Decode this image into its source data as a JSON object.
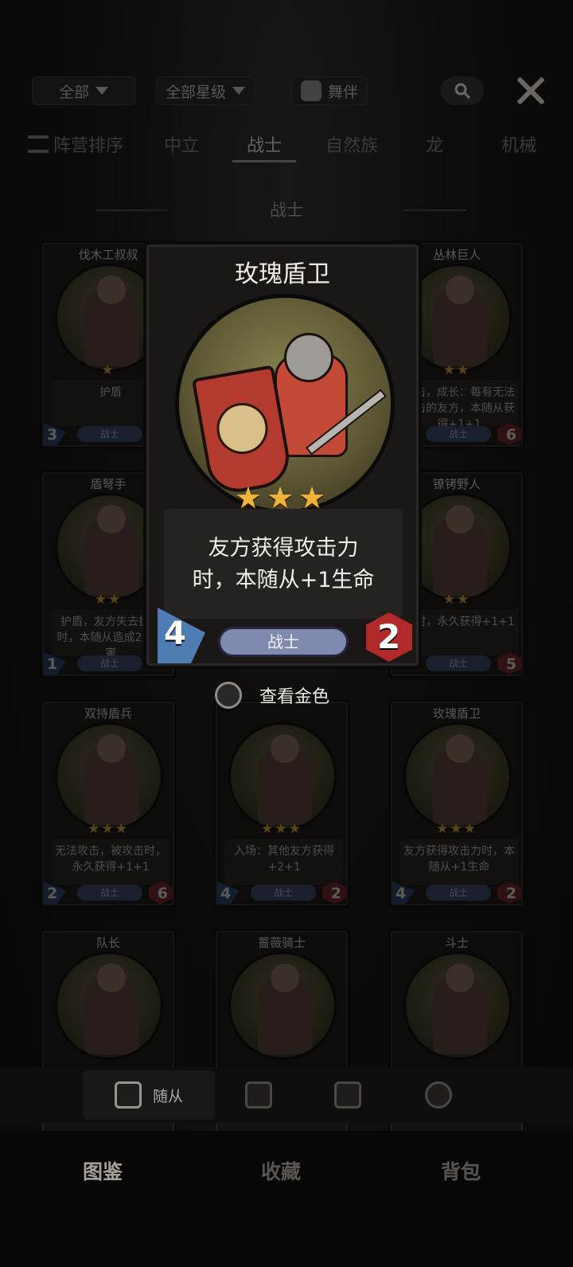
{
  "filters": {
    "all_label": "全部",
    "stars_label": "全部星级",
    "companion_label": "舞伴"
  },
  "tabs": [
    {
      "label": "阵营排序"
    },
    {
      "label": "中立"
    },
    {
      "label": "战士"
    },
    {
      "label": "自然族"
    },
    {
      "label": "龙"
    },
    {
      "label": "机械"
    }
  ],
  "section_title": "战士",
  "cards": [
    {
      "name": "伐木工叔叔",
      "stars": "★",
      "desc": "护盾",
      "tribe": "战士",
      "atk": "3",
      "hp": ""
    },
    {
      "name": "丛林巨人",
      "stars": "★★",
      "desc": "攻击，成长：每有无法攻击的友方，本随从获得+1+1",
      "tribe": "战士",
      "atk": "",
      "hp": "6"
    },
    {
      "name": "盾弩手",
      "stars": "★★",
      "desc": "护盾，友方失去护盾时，本随从造成2点伤害",
      "tribe": "战士",
      "atk": "1",
      "hp": ""
    },
    {
      "name": "镣铐野人",
      "stars": "★★",
      "desc": "击时，永久获得+1+1",
      "tribe": "战士",
      "atk": "",
      "hp": "5"
    },
    {
      "name": "双持盾兵",
      "stars": "★★★",
      "desc": "无法攻击，被攻击时，永久获得+1+1",
      "tribe": "战士",
      "atk": "2",
      "hp": "6"
    },
    {
      "name": "",
      "stars": "★★★",
      "desc": "入场：其他友方获得+2+1",
      "tribe": "战士",
      "atk": "4",
      "hp": "2"
    },
    {
      "name": "玫瑰盾卫",
      "stars": "★★★",
      "desc": "友方获得攻击力时，本随从+1生命",
      "tribe": "战士",
      "atk": "4",
      "hp": "2"
    },
    {
      "name": "队长",
      "stars": "",
      "desc": "",
      "tribe": "",
      "atk": "",
      "hp": ""
    },
    {
      "name": "蔷薇骑士",
      "stars": "",
      "desc": "",
      "tribe": "",
      "atk": "",
      "hp": ""
    },
    {
      "name": "斗士",
      "stars": "",
      "desc": "",
      "tribe": "",
      "atk": "",
      "hp": ""
    }
  ],
  "detail": {
    "name": "玫瑰盾卫",
    "stars": "★★★",
    "desc_line1": "友方获得攻击力",
    "desc_line2": "时，本随从+1生命",
    "tribe": "战士",
    "atk": "4",
    "hp": "2"
  },
  "golden_toggle_label": "查看金色",
  "sub_tabs": [
    {
      "label": "随从",
      "icon": "minion-cards-icon"
    },
    {
      "label": "",
      "icon": "spell-cards-icon"
    },
    {
      "label": "",
      "icon": "trinket-cards-icon"
    },
    {
      "label": "",
      "icon": "hero-icon"
    }
  ],
  "main_tabs": [
    {
      "label": "图鉴"
    },
    {
      "label": "收藏"
    },
    {
      "label": "背包"
    }
  ]
}
